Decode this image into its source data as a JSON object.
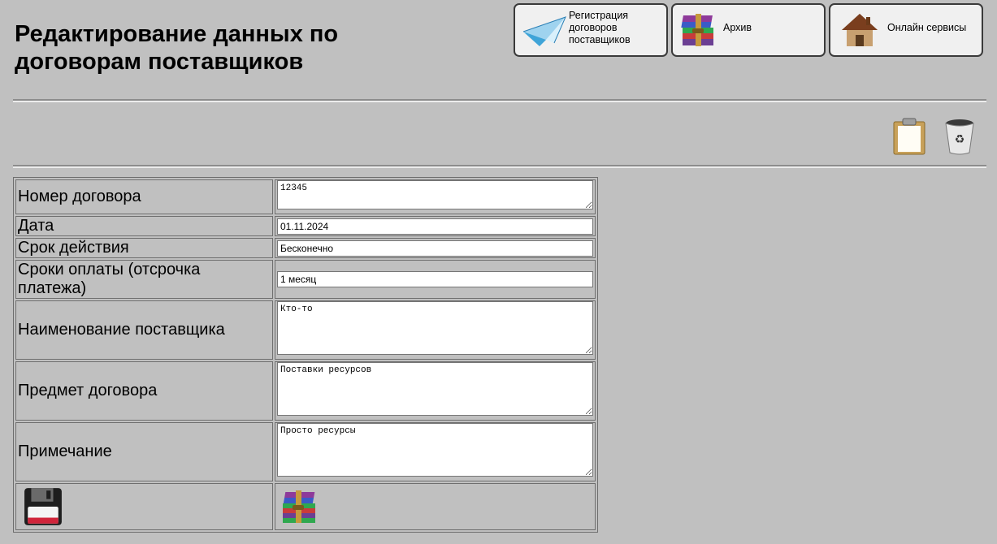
{
  "header": {
    "title": "Редактирование данных по договорам поставщиков"
  },
  "nav": {
    "registration_label": "Регистрация\nдоговоров\nпоставщиков",
    "archive_label": "Архив",
    "online_label": "Онлайн сервисы"
  },
  "form": {
    "contract_number": {
      "label": "Номер договора",
      "value": "12345"
    },
    "date": {
      "label": "Дата",
      "value": "01.11.2024"
    },
    "validity": {
      "label": "Срок действия",
      "value": "Бесконечно"
    },
    "payment_terms": {
      "label": "Сроки оплаты (отсрочка платежа)",
      "value": "1 месяц"
    },
    "supplier_name": {
      "label": "Наименование поставщика",
      "value": "Кто-то"
    },
    "subject": {
      "label": "Предмет договора",
      "value": "Поставки ресурсов"
    },
    "note": {
      "label": "Примечание",
      "value": "Просто ресурсы"
    }
  },
  "icons": {
    "registration": "paper-plane-icon",
    "archive": "winrar-archive-icon",
    "online": "house-icon",
    "clipboard": "clipboard-icon",
    "trash": "recycle-bin-icon",
    "save": "floppy-disk-icon",
    "archive_action": "winrar-archive-icon"
  },
  "colors": {
    "background": "#c0c0c0",
    "button_bg": "#f0f0f0"
  }
}
